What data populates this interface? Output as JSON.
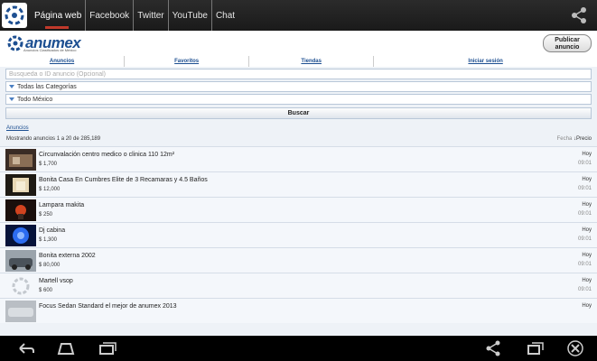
{
  "appbar": {
    "tabs": [
      "Página web",
      "Facebook",
      "Twitter",
      "YouTube",
      "Chat"
    ],
    "active_tab": 0
  },
  "site": {
    "brand": "anumex",
    "brand_sub": "Anuncios Clasificados de México",
    "publish_label_1": "Publicar",
    "publish_label_2": "anuncio",
    "nav": [
      "Anuncios",
      "Favoritos",
      "Tiendas",
      "Iniciar sesión"
    ],
    "search_placeholder": "Busqueda o ID anuncio (Opcional)",
    "category": "Todas las Categorías",
    "location": "Todo México",
    "search_button": "Buscar",
    "breadcrumb": "Anuncios",
    "showing": "Mostrando anuncios 1 a 20 de 285,189",
    "sort_date": "Fecha",
    "sort_price": "↓Precio"
  },
  "listings": [
    {
      "title": "Circunvalación centro medico o clinica 110 12m²",
      "price": "$ 1,700",
      "day": "Hoy",
      "time": "09:01"
    },
    {
      "title": "Bonita Casa En Cumbres Elite de 3 Recamaras y 4.5 Baños",
      "price": "$ 12,000",
      "day": "Hoy",
      "time": "09:01"
    },
    {
      "title": "Lampara makita",
      "price": "$ 250",
      "day": "Hoy",
      "time": "09:01"
    },
    {
      "title": "Dj cabina",
      "price": "$ 1,300",
      "day": "Hoy",
      "time": "09:01"
    },
    {
      "title": "Bonita externa 2002",
      "price": "$ 80,000",
      "day": "Hoy",
      "time": "09:01"
    },
    {
      "title": "Martell vsop",
      "price": "$ 600",
      "day": "Hoy",
      "time": "09:01"
    },
    {
      "title": "Focus Sedan Standard el mejor de anumex 2013",
      "price": "",
      "day": "Hoy",
      "time": ""
    }
  ],
  "colors": {
    "brand": "#1d4f91",
    "tab_indicator": "#c0392b"
  }
}
